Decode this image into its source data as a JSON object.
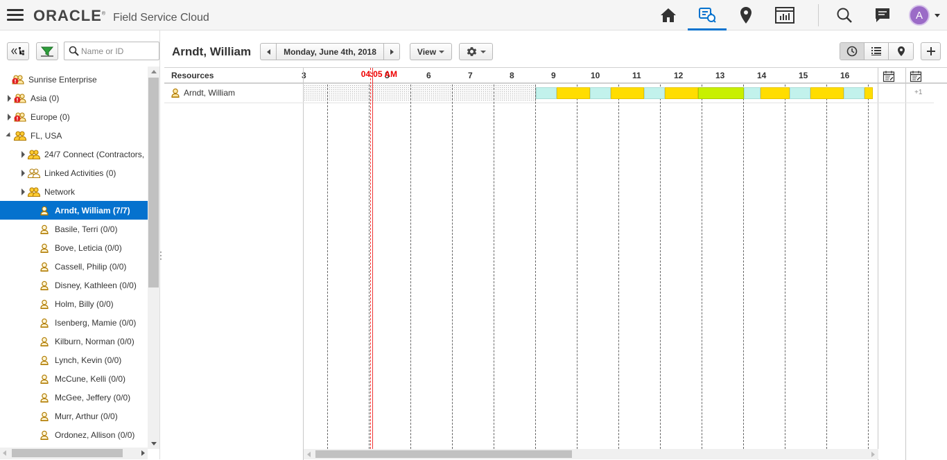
{
  "header": {
    "logo": "ORACLE",
    "logo_mark": "®",
    "product": "Field Service Cloud",
    "nav_icons": [
      "home-icon",
      "dispatch-console-icon",
      "map-pin-icon",
      "reports-icon",
      "search-icon",
      "messages-icon"
    ],
    "active_nav": "dispatch-console-icon",
    "user_initial": "A",
    "accent_color": "#0572ce",
    "avatar_color": "#9b6bc7"
  },
  "sidebar": {
    "search_placeholder": "Name or ID",
    "tree": [
      {
        "label": "Sunrise Enterprise",
        "icon": "group-alert-icon",
        "arrow": "none",
        "indent": 0
      },
      {
        "label": "Asia (0)",
        "icon": "group-alert-icon",
        "arrow": "collapsed",
        "indent": 1
      },
      {
        "label": "Europe (0)",
        "icon": "group-alert-icon",
        "arrow": "collapsed",
        "indent": 1
      },
      {
        "label": "FL, USA",
        "icon": "group-icon",
        "arrow": "expanded",
        "indent": 1
      },
      {
        "label": "24/7 Connect (Contractors,",
        "icon": "group-icon",
        "arrow": "collapsed",
        "indent": 2
      },
      {
        "label": "Linked Activities (0)",
        "icon": "group-outline-icon",
        "arrow": "collapsed",
        "indent": 2
      },
      {
        "label": "Network",
        "icon": "group-icon",
        "arrow": "collapsed",
        "indent": 2
      },
      {
        "label": "Arndt, William (7/7)",
        "icon": "user-icon",
        "arrow": "none",
        "indent": 3,
        "selected": true
      },
      {
        "label": "Basile, Terri (0/0)",
        "icon": "user-icon",
        "arrow": "none",
        "indent": 3
      },
      {
        "label": "Bove, Leticia (0/0)",
        "icon": "user-icon",
        "arrow": "none",
        "indent": 3
      },
      {
        "label": "Cassell, Philip (0/0)",
        "icon": "user-icon",
        "arrow": "none",
        "indent": 3
      },
      {
        "label": "Disney, Kathleen (0/0)",
        "icon": "user-icon",
        "arrow": "none",
        "indent": 3
      },
      {
        "label": "Holm, Billy (0/0)",
        "icon": "user-icon",
        "arrow": "none",
        "indent": 3
      },
      {
        "label": "Isenberg, Mamie (0/0)",
        "icon": "user-icon",
        "arrow": "none",
        "indent": 3
      },
      {
        "label": "Kilburn, Norman (0/0)",
        "icon": "user-icon",
        "arrow": "none",
        "indent": 3
      },
      {
        "label": "Lynch, Kevin (0/0)",
        "icon": "user-icon",
        "arrow": "none",
        "indent": 3
      },
      {
        "label": "McCune, Kelli (0/0)",
        "icon": "user-icon",
        "arrow": "none",
        "indent": 3
      },
      {
        "label": "McGee, Jeffery (0/0)",
        "icon": "user-icon",
        "arrow": "none",
        "indent": 3
      },
      {
        "label": "Murr, Arthur (0/0)",
        "icon": "user-icon",
        "arrow": "none",
        "indent": 3
      },
      {
        "label": "Ordonez, Allison (0/0)",
        "icon": "user-icon",
        "arrow": "none",
        "indent": 3
      }
    ]
  },
  "main": {
    "resource_title": "Arndt, William",
    "date_label": "Monday, June 4th, 2018",
    "view_label": "View",
    "view_modes": [
      "time-view-icon",
      "list-view-icon",
      "map-view-icon"
    ],
    "active_view": "time-view-icon",
    "gantt": {
      "resources_header": "Resources",
      "hours": [
        "3",
        "4",
        "5",
        "6",
        "7",
        "8",
        "9",
        "10",
        "11",
        "12",
        "13",
        "14",
        "15",
        "16"
      ],
      "now_label": "04:05 AM",
      "resource_name": "Arndt, William",
      "overflow_label": "+1",
      "blocks": [
        {
          "type": "travel",
          "start": 8.0,
          "end": 8.5
        },
        {
          "type": "act",
          "start": 8.5,
          "end": 9.3
        },
        {
          "type": "travel",
          "start": 9.3,
          "end": 9.8
        },
        {
          "type": "act",
          "start": 9.8,
          "end": 10.6
        },
        {
          "type": "travel",
          "start": 10.6,
          "end": 11.1
        },
        {
          "type": "act",
          "start": 11.1,
          "end": 11.9
        },
        {
          "type": "green",
          "start": 11.9,
          "end": 13.0
        },
        {
          "type": "travel",
          "start": 13.0,
          "end": 13.4
        },
        {
          "type": "act",
          "start": 13.4,
          "end": 14.1
        },
        {
          "type": "travel",
          "start": 14.1,
          "end": 14.6
        },
        {
          "type": "act",
          "start": 14.6,
          "end": 15.4
        },
        {
          "type": "travel",
          "start": 15.4,
          "end": 15.9
        },
        {
          "type": "act",
          "start": 15.9,
          "end": 16.1
        }
      ],
      "now_hour": 4.08,
      "colors": {
        "travel": "#c2f2ec",
        "activity": "#ffdd00",
        "completed": "#c8f000",
        "now": "#e00000"
      }
    }
  }
}
